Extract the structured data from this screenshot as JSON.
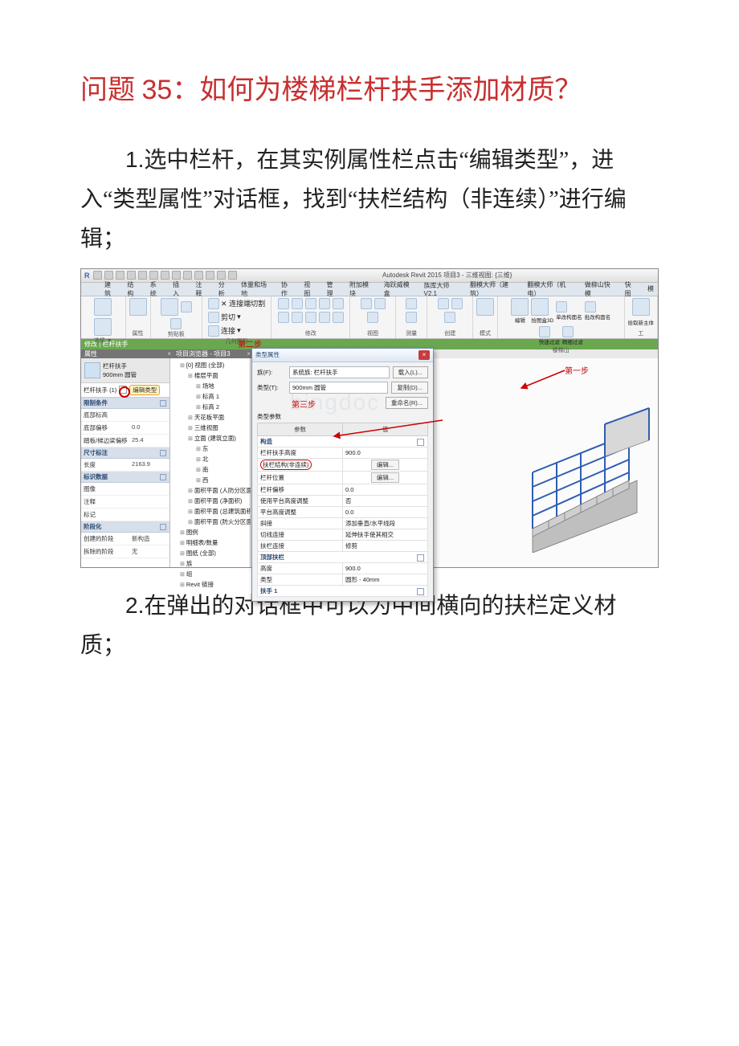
{
  "domain": "Document",
  "title_prefix": "问题 ",
  "title_num": "35",
  "title_colon": "：",
  "title_text": "如何为楼梯栏杆扶手添加材质？",
  "para1_num": "1.",
  "para1_text": "选中栏杆，在其实例属性栏点击“编辑类型”，进入“类型属性”对话框，找到“扶栏结构（非连续）”进行编辑；",
  "para2_num": "2.",
  "para2_text": "在弹出的对话框中可以为中间横向的扶栏定义材质；",
  "revit": {
    "app_title": "Autodesk Revit 2015 ",
    "doc_title": "项目3 - 三维视图: {三维}",
    "tabs": [
      "建筑",
      "结构",
      "系统",
      "插入",
      "注释",
      "分析",
      "体量和场地",
      "协作",
      "视图",
      "管理",
      "附加模块",
      "海跃威模盒",
      "族库大师V2.1",
      "翻模大师（建筑）",
      "翻模大师（机电）",
      "做柳山快模",
      "快图",
      "模"
    ],
    "panels": [
      {
        "label": "选择 ▼",
        "big": 1,
        "small": 0
      },
      {
        "label": "属性",
        "big": 1,
        "small": 0
      },
      {
        "label": "剪贴板",
        "big": 1,
        "small": 2
      },
      {
        "label": "几何图形",
        "big": 0,
        "small": 6,
        "lines": [
          "✕ 连接端切割",
          "剪切",
          "连接"
        ]
      },
      {
        "label": "修改",
        "big": 0,
        "small": 10
      },
      {
        "label": "视图",
        "big": 0,
        "small": 3
      },
      {
        "label": "测量",
        "big": 0,
        "small": 2
      },
      {
        "label": "创建",
        "big": 0,
        "small": 3
      },
      {
        "label": "模式",
        "big": 1,
        "small": 0
      },
      {
        "label": "楼梯山",
        "big": 0,
        "small": 6,
        "sublabels": [
          "编辑",
          "拾图盒3D",
          "单改构面名",
          "批改构面名",
          "快速过滤",
          "精细过滤"
        ]
      },
      {
        "label": "工",
        "big": 1,
        "small": 0,
        "sublabels": [
          "拾取新主体"
        ]
      }
    ],
    "greenbar": "修改 | 栏杆扶手",
    "prop_panel_title": "属性",
    "prop_type_name": "栏杆扶手",
    "prop_type_sub": "900mm 圆管",
    "prop_selected": "栏杆扶手 (1)",
    "edit_type_label": "编辑类型",
    "prop_groups": [
      {
        "group": "限制条件",
        "rows": [
          [
            "底部标高",
            ""
          ],
          [
            "底部偏移",
            "0.0"
          ],
          [
            "踏板/梯边梁偏移",
            "25.4"
          ]
        ]
      },
      {
        "group": "尺寸标注",
        "rows": [
          [
            "长度",
            "2163.9"
          ]
        ]
      },
      {
        "group": "标识数据",
        "rows": [
          [
            "图像",
            ""
          ],
          [
            "注释",
            ""
          ],
          [
            "标记",
            ""
          ]
        ]
      },
      {
        "group": "阶段化",
        "rows": [
          [
            "创建的阶段",
            "新构造"
          ],
          [
            "拆除的阶段",
            "无"
          ]
        ]
      }
    ],
    "browser_title": "项目浏览器 - 项目3",
    "browser_tree": [
      {
        "t": "[0] 视图 (全部)",
        "sel": false,
        "children": [
          {
            "t": "楼层平面",
            "children": [
              {
                "t": "场地"
              },
              {
                "t": "标高 1"
              },
              {
                "t": "标高 2"
              }
            ]
          },
          {
            "t": "天花板平面"
          },
          {
            "t": "三维视图"
          },
          {
            "t": "立面 (建筑立面)",
            "children": [
              {
                "t": "东"
              },
              {
                "t": "北"
              },
              {
                "t": "南"
              },
              {
                "t": "西"
              }
            ]
          },
          {
            "t": "面积平面 (人防分区面"
          },
          {
            "t": "面积平面 (净面积)"
          },
          {
            "t": "面积平面 (总建筑面积"
          },
          {
            "t": "面积平面 (防火分区面"
          }
        ]
      },
      {
        "t": "图例"
      },
      {
        "t": "明细表/数量"
      },
      {
        "t": "图纸 (全部)"
      },
      {
        "t": "族"
      },
      {
        "t": "组"
      },
      {
        "t": "Revit 链接"
      }
    ],
    "dialog": {
      "title": "类型属性",
      "family_lbl": "族(F):",
      "family_val": "系统族: 栏杆扶手",
      "type_lbl": "类型(T):",
      "type_val": "900mm 圆管",
      "btn_load": "载入(L)...",
      "btn_dup": "复制(D)...",
      "btn_rename": "重命名(R)...",
      "params_lbl": "类型参数",
      "col_param": "参数",
      "col_value": "值",
      "grp_construct": "构造",
      "rows_construct": [
        [
          "栏杆扶手高度",
          "900.0"
        ],
        [
          "扶栏结构(非连续)",
          "__edit__"
        ],
        [
          "栏杆位置",
          "__edit__"
        ],
        [
          "栏杆偏移",
          "0.0"
        ],
        [
          "使用平台高度调整",
          "否"
        ],
        [
          "平台高度调整",
          "0.0"
        ],
        [
          "斜接",
          "添加垂直/水平线段"
        ],
        [
          "切线连接",
          "延伸扶手使其相交"
        ],
        [
          "扶栏连接",
          "修剪"
        ]
      ],
      "grp_top": "顶部扶栏",
      "rows_top": [
        [
          "高度",
          "900.0"
        ],
        [
          "类型",
          "圆形 - 40mm"
        ]
      ],
      "grp_handrail1": "扶手 1",
      "edit_btn": "编辑..."
    },
    "steps": {
      "s1": "第一步",
      "s2": "第二步",
      "s3": "第三步"
    }
  }
}
